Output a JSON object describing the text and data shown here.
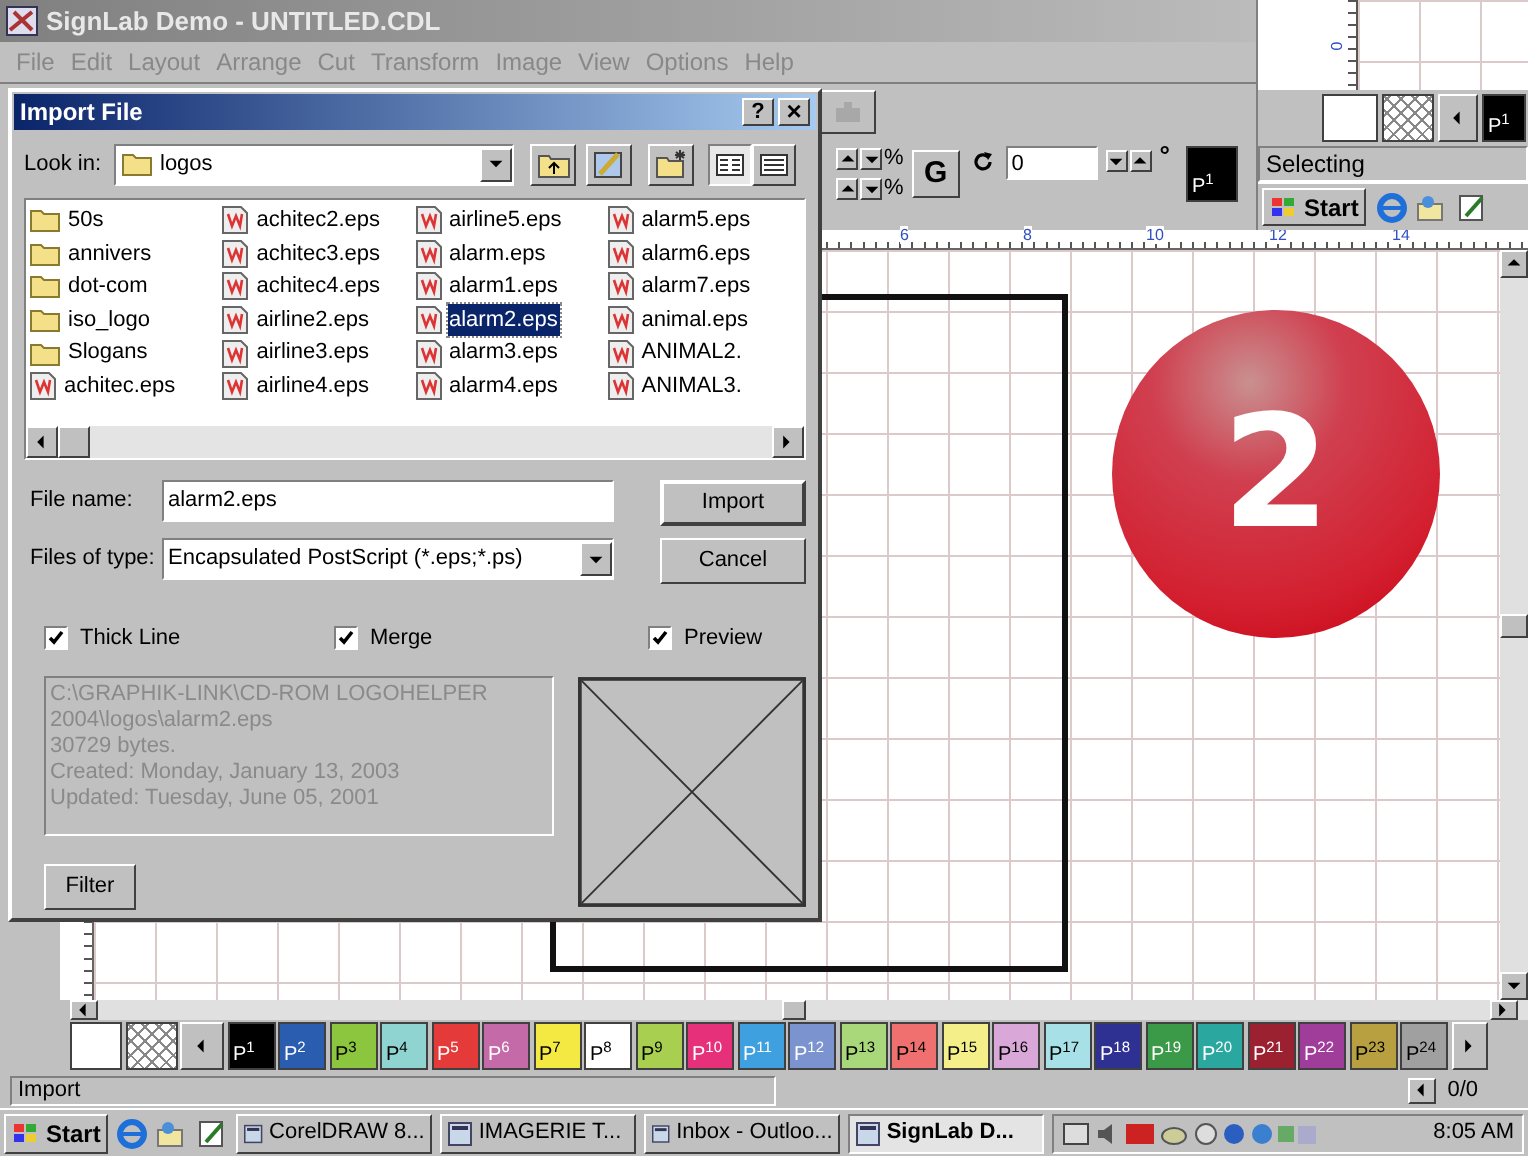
{
  "app": {
    "title": "SignLab Demo - UNTITLED.CDL",
    "menu": [
      "File",
      "Edit",
      "Layout",
      "Arrange",
      "Cut",
      "Transform",
      "Image",
      "View",
      "Options",
      "Help"
    ]
  },
  "toolbar": {
    "percent_labels": [
      "%",
      "%"
    ],
    "g_button": "G",
    "rotation": {
      "value": "0",
      "unit": "°"
    },
    "current_color": {
      "label": "P$^{1}$",
      "color": "#000000"
    }
  },
  "inset": {
    "ruler_label": "0",
    "swatch": {
      "label": "P$^{1}$",
      "color": "#000000"
    },
    "status": "Selecting",
    "start": "Start"
  },
  "ruler": {
    "labels": [
      "6",
      "8",
      "10",
      "12",
      "14"
    ]
  },
  "step_badge": "2",
  "dialog": {
    "title": "Import File",
    "help": "?",
    "close": "×",
    "look_in": {
      "label": "Look in:",
      "value": "logos"
    },
    "view_buttons": [
      {
        "kind": "list",
        "selected": true
      },
      {
        "kind": "details",
        "selected": false
      }
    ],
    "files": [
      {
        "name": "50s",
        "kind": "folder",
        "selected": false
      },
      {
        "name": "annivers",
        "kind": "folder",
        "selected": false
      },
      {
        "name": "dot-com",
        "kind": "folder",
        "selected": false
      },
      {
        "name": "iso_logo",
        "kind": "folder",
        "selected": false
      },
      {
        "name": "Slogans",
        "kind": "folder",
        "selected": false
      },
      {
        "name": "achitec.eps",
        "kind": "file",
        "selected": false
      },
      {
        "name": "achitec2.eps",
        "kind": "file",
        "selected": false
      },
      {
        "name": "achitec3.eps",
        "kind": "file",
        "selected": false
      },
      {
        "name": "achitec4.eps",
        "kind": "file",
        "selected": false
      },
      {
        "name": "airline2.eps",
        "kind": "file",
        "selected": false
      },
      {
        "name": "airline3.eps",
        "kind": "file",
        "selected": false
      },
      {
        "name": "airline4.eps",
        "kind": "file",
        "selected": false
      },
      {
        "name": "airline5.eps",
        "kind": "file",
        "selected": false
      },
      {
        "name": "alarm.eps",
        "kind": "file",
        "selected": false
      },
      {
        "name": "alarm1.eps",
        "kind": "file",
        "selected": false
      },
      {
        "name": "alarm2.eps",
        "kind": "file",
        "selected": true
      },
      {
        "name": "alarm3.eps",
        "kind": "file",
        "selected": false
      },
      {
        "name": "alarm4.eps",
        "kind": "file",
        "selected": false
      },
      {
        "name": "alarm5.eps",
        "kind": "file",
        "selected": false
      },
      {
        "name": "alarm6.eps",
        "kind": "file",
        "selected": false
      },
      {
        "name": "alarm7.eps",
        "kind": "file",
        "selected": false
      },
      {
        "name": "animal.eps",
        "kind": "file",
        "selected": false
      },
      {
        "name": "ANIMAL2.",
        "kind": "file",
        "selected": false
      },
      {
        "name": "ANIMAL3.",
        "kind": "file",
        "selected": false
      }
    ],
    "file_name": {
      "label": "File name:",
      "value": "alarm2.eps"
    },
    "file_type": {
      "label": "Files of type:",
      "value": "Encapsulated PostScript (*.eps;*.ps)"
    },
    "import_button": "Import",
    "cancel_button": "Cancel",
    "options": [
      {
        "label": "Thick Line",
        "checked": true
      },
      {
        "label": "Merge",
        "checked": true
      },
      {
        "label": "Preview",
        "checked": true
      }
    ],
    "info": [
      "C:\\GRAPHIK-LINK\\CD-ROM LOGOHELPER",
      "2004\\logos\\alarm2.eps",
      "30729 bytes.",
      "Created: Monday, January 13, 2003",
      "Updated: Tuesday, June 05, 2001"
    ],
    "filter_button": "Filter"
  },
  "palette": {
    "swatches": [
      {
        "label": "P$^{1}$",
        "color": "#000000"
      },
      {
        "label": "P$^{2}$",
        "color": "#2a5db0"
      },
      {
        "label": "P$^{3}$",
        "color": "#8cc63f"
      },
      {
        "label": "P$^{4}$",
        "color": "#8fd4d0"
      },
      {
        "label": "P$^{5}$",
        "color": "#e53a3a"
      },
      {
        "label": "P$^{6}$",
        "color": "#c46aa8"
      },
      {
        "label": "P$^{7}$",
        "color": "#f4e842"
      },
      {
        "label": "P$^{8}$",
        "color": "#ffffff"
      },
      {
        "label": "P$^{9}$",
        "color": "#a9cf50"
      },
      {
        "label": "P$^{10}$",
        "color": "#e6307a"
      },
      {
        "label": "P$^{11}$",
        "color": "#3fa0e0"
      },
      {
        "label": "P$^{12}$",
        "color": "#7b93cf"
      },
      {
        "label": "P$^{13}$",
        "color": "#a8d87a"
      },
      {
        "label": "P$^{14}$",
        "color": "#f07070"
      },
      {
        "label": "P$^{15}$",
        "color": "#f5ef8a"
      },
      {
        "label": "P$^{16}$",
        "color": "#d9a8d8"
      },
      {
        "label": "P$^{17}$",
        "color": "#a8e0e8"
      },
      {
        "label": "P$^{18}$",
        "color": "#2e3192"
      },
      {
        "label": "P$^{19}$",
        "color": "#3a9a48"
      },
      {
        "label": "P$^{20}$",
        "color": "#2aa8a0"
      },
      {
        "label": "P$^{21}$",
        "color": "#9b2030"
      },
      {
        "label": "P$^{22}$",
        "color": "#a03c9a"
      },
      {
        "label": "P$^{23}$",
        "color": "#b8a040"
      },
      {
        "label": "P$^{24}$",
        "color": "#a0a0a0"
      }
    ]
  },
  "status_bar": {
    "message": "Import",
    "page": "0/0"
  },
  "taskbar": {
    "start": "Start",
    "tasks": [
      {
        "label": "CorelDRAW 8...",
        "selected": false
      },
      {
        "label": "IMAGERIE T...",
        "selected": false
      },
      {
        "label": "Inbox - Outloo...",
        "selected": false
      },
      {
        "label": "SignLab D...",
        "selected": true
      }
    ],
    "clock": "8:05 AM"
  }
}
